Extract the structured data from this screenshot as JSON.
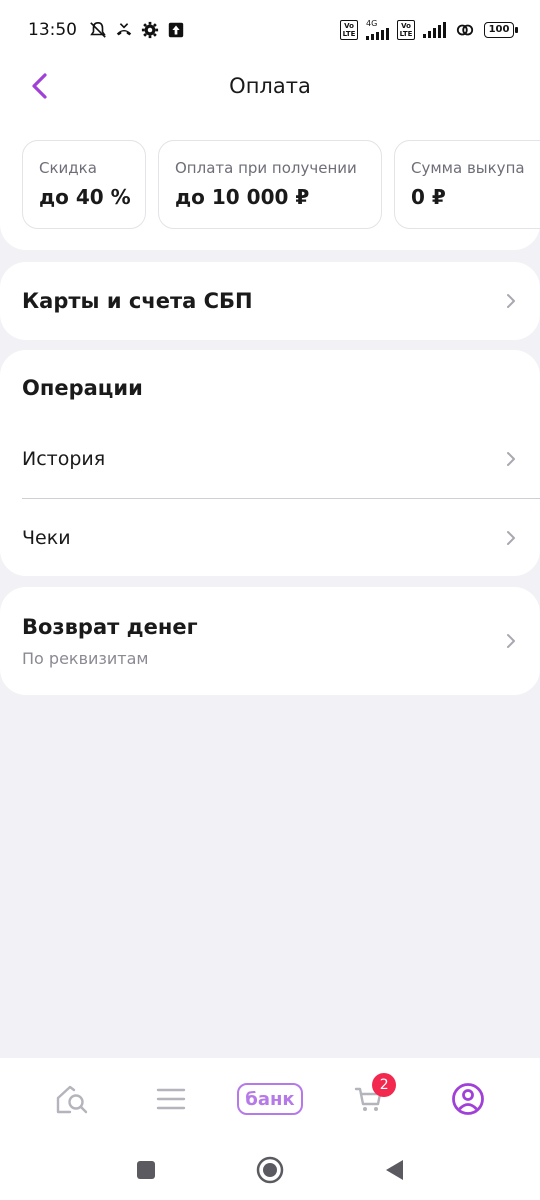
{
  "status_bar": {
    "time": "13:50",
    "network_label": "4G",
    "volte_1": "Vo LTE",
    "volte_2": "Vo LTE",
    "battery": "100",
    "icons": [
      "mute-icon",
      "missed-call-icon",
      "gear-icon",
      "upload-icon",
      "signal-icon",
      "link-icon",
      "battery-icon"
    ]
  },
  "header": {
    "title": "Оплата",
    "back_icon": "chevron-left-icon"
  },
  "chips": [
    {
      "label": "Скидка",
      "value": "до 40 %"
    },
    {
      "label": "Оплата при получении",
      "value": "до 10 000 ₽"
    },
    {
      "label": "Сумма выкупа",
      "value": "0 ₽"
    }
  ],
  "cards_section": {
    "title": "Карты и счета СБП"
  },
  "operations": {
    "title": "Операции",
    "items": [
      {
        "label": "История"
      },
      {
        "label": "Чеки"
      }
    ]
  },
  "refund": {
    "title": "Возврат денег",
    "subtitle": "По реквизитам"
  },
  "bottom_nav": {
    "items": [
      {
        "name": "home",
        "icon": "home-search-icon"
      },
      {
        "name": "catalog",
        "icon": "menu-icon"
      },
      {
        "name": "bank",
        "label": "банк"
      },
      {
        "name": "cart",
        "icon": "cart-icon",
        "badge": "2"
      },
      {
        "name": "profile",
        "icon": "profile-icon"
      }
    ]
  },
  "colors": {
    "accent": "#a040d8",
    "bank_accent": "#b679e8",
    "badge": "#f2284f",
    "background": "#f2f2f6"
  }
}
